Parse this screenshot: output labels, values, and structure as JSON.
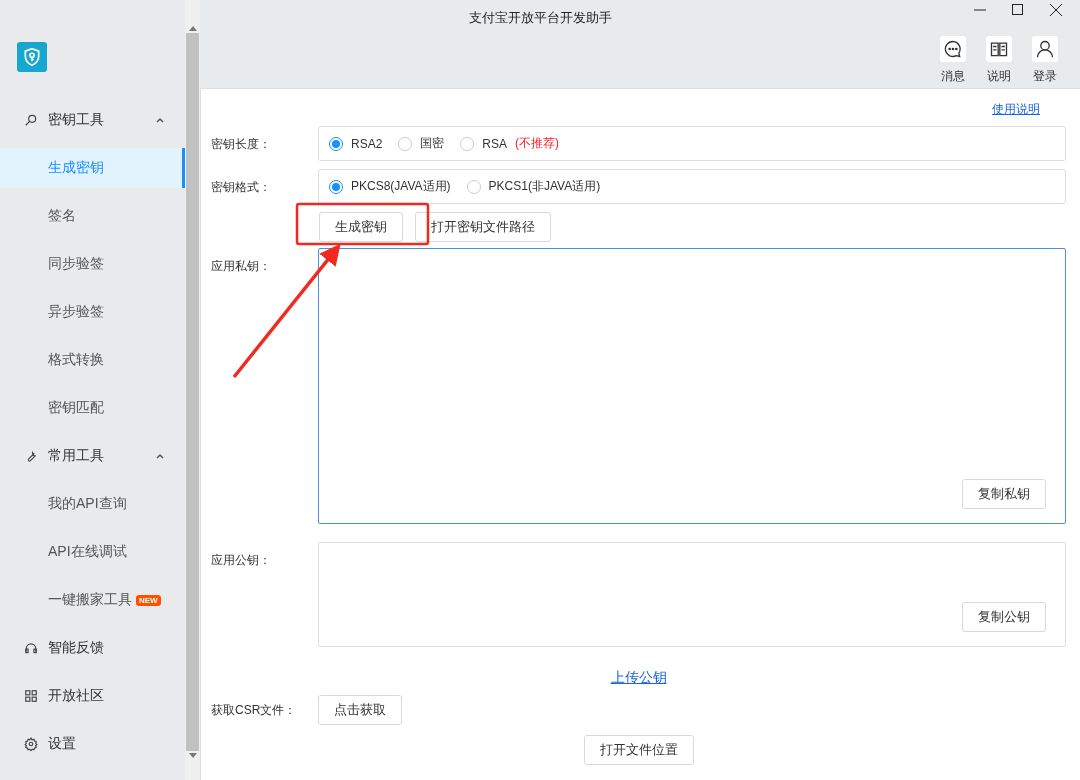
{
  "window": {
    "title": "支付宝开放平台开发助手"
  },
  "header_actions": [
    {
      "label": "消息"
    },
    {
      "label": "说明"
    },
    {
      "label": "登录"
    }
  ],
  "sidebar": [
    {
      "kind": "group",
      "label": "密钥工具",
      "expanded": true,
      "children": [
        {
          "label": "生成密钥",
          "selected": true
        },
        {
          "label": "签名",
          "selected": false
        },
        {
          "label": "同步验签",
          "selected": false
        },
        {
          "label": "异步验签",
          "selected": false
        },
        {
          "label": "格式转换",
          "selected": false
        },
        {
          "label": "密钥匹配",
          "selected": false
        }
      ]
    },
    {
      "kind": "group",
      "label": "常用工具",
      "expanded": true,
      "children": [
        {
          "label": "我的API查询",
          "selected": false
        },
        {
          "label": "API在线调试",
          "selected": false
        },
        {
          "label": "一键搬家工具",
          "badge": "NEW",
          "selected": false
        }
      ]
    },
    {
      "kind": "link",
      "label": "智能反馈"
    },
    {
      "kind": "link",
      "label": "开放社区"
    },
    {
      "kind": "link",
      "label": "设置"
    }
  ],
  "help_link": "使用说明",
  "radio_rows": [
    {
      "label": "密钥长度：",
      "options": [
        {
          "label": "RSA2",
          "selected": true
        },
        {
          "label": "国密",
          "selected": false
        },
        {
          "label": "RSA",
          "note": "(不推荐)",
          "selected": false
        }
      ]
    },
    {
      "label": "密钥格式：",
      "options": [
        {
          "label": "PKCS8(JAVA适用)",
          "selected": true
        },
        {
          "label": "PKCS1(非JAVA适用)",
          "selected": false
        }
      ]
    }
  ],
  "action_buttons": [
    "生成密钥",
    "打开密钥文件路径"
  ],
  "private_key": {
    "label": "应用私钥：",
    "button": "复制私钥"
  },
  "public_key": {
    "label": "应用公钥：",
    "button": "复制公钥"
  },
  "upload_link": "上传公钥",
  "csr": {
    "label": "获取CSR文件：",
    "button": "点击获取"
  },
  "open_location_button": "打开文件位置",
  "annotations": {
    "highlight_frame": true,
    "arrow": true
  }
}
